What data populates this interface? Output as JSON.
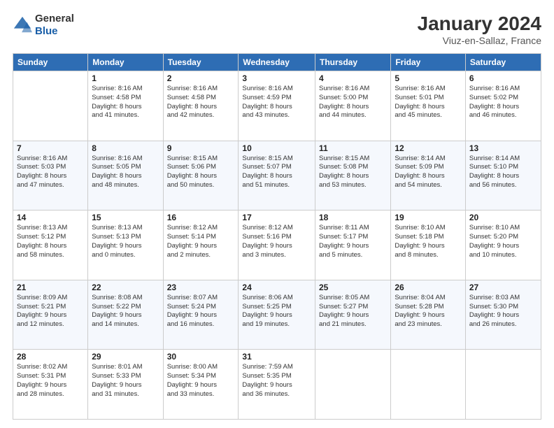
{
  "header": {
    "logo": {
      "general": "General",
      "blue": "Blue"
    },
    "title": "January 2024",
    "location": "Viuz-en-Sallaz, France"
  },
  "weekdays": [
    "Sunday",
    "Monday",
    "Tuesday",
    "Wednesday",
    "Thursday",
    "Friday",
    "Saturday"
  ],
  "weeks": [
    [
      {
        "day": "",
        "info": ""
      },
      {
        "day": "1",
        "info": "Sunrise: 8:16 AM\nSunset: 4:58 PM\nDaylight: 8 hours\nand 41 minutes."
      },
      {
        "day": "2",
        "info": "Sunrise: 8:16 AM\nSunset: 4:58 PM\nDaylight: 8 hours\nand 42 minutes."
      },
      {
        "day": "3",
        "info": "Sunrise: 8:16 AM\nSunset: 4:59 PM\nDaylight: 8 hours\nand 43 minutes."
      },
      {
        "day": "4",
        "info": "Sunrise: 8:16 AM\nSunset: 5:00 PM\nDaylight: 8 hours\nand 44 minutes."
      },
      {
        "day": "5",
        "info": "Sunrise: 8:16 AM\nSunset: 5:01 PM\nDaylight: 8 hours\nand 45 minutes."
      },
      {
        "day": "6",
        "info": "Sunrise: 8:16 AM\nSunset: 5:02 PM\nDaylight: 8 hours\nand 46 minutes."
      }
    ],
    [
      {
        "day": "7",
        "info": "Sunrise: 8:16 AM\nSunset: 5:03 PM\nDaylight: 8 hours\nand 47 minutes."
      },
      {
        "day": "8",
        "info": "Sunrise: 8:16 AM\nSunset: 5:05 PM\nDaylight: 8 hours\nand 48 minutes."
      },
      {
        "day": "9",
        "info": "Sunrise: 8:15 AM\nSunset: 5:06 PM\nDaylight: 8 hours\nand 50 minutes."
      },
      {
        "day": "10",
        "info": "Sunrise: 8:15 AM\nSunset: 5:07 PM\nDaylight: 8 hours\nand 51 minutes."
      },
      {
        "day": "11",
        "info": "Sunrise: 8:15 AM\nSunset: 5:08 PM\nDaylight: 8 hours\nand 53 minutes."
      },
      {
        "day": "12",
        "info": "Sunrise: 8:14 AM\nSunset: 5:09 PM\nDaylight: 8 hours\nand 54 minutes."
      },
      {
        "day": "13",
        "info": "Sunrise: 8:14 AM\nSunset: 5:10 PM\nDaylight: 8 hours\nand 56 minutes."
      }
    ],
    [
      {
        "day": "14",
        "info": "Sunrise: 8:13 AM\nSunset: 5:12 PM\nDaylight: 8 hours\nand 58 minutes."
      },
      {
        "day": "15",
        "info": "Sunrise: 8:13 AM\nSunset: 5:13 PM\nDaylight: 9 hours\nand 0 minutes."
      },
      {
        "day": "16",
        "info": "Sunrise: 8:12 AM\nSunset: 5:14 PM\nDaylight: 9 hours\nand 2 minutes."
      },
      {
        "day": "17",
        "info": "Sunrise: 8:12 AM\nSunset: 5:16 PM\nDaylight: 9 hours\nand 3 minutes."
      },
      {
        "day": "18",
        "info": "Sunrise: 8:11 AM\nSunset: 5:17 PM\nDaylight: 9 hours\nand 5 minutes."
      },
      {
        "day": "19",
        "info": "Sunrise: 8:10 AM\nSunset: 5:18 PM\nDaylight: 9 hours\nand 8 minutes."
      },
      {
        "day": "20",
        "info": "Sunrise: 8:10 AM\nSunset: 5:20 PM\nDaylight: 9 hours\nand 10 minutes."
      }
    ],
    [
      {
        "day": "21",
        "info": "Sunrise: 8:09 AM\nSunset: 5:21 PM\nDaylight: 9 hours\nand 12 minutes."
      },
      {
        "day": "22",
        "info": "Sunrise: 8:08 AM\nSunset: 5:22 PM\nDaylight: 9 hours\nand 14 minutes."
      },
      {
        "day": "23",
        "info": "Sunrise: 8:07 AM\nSunset: 5:24 PM\nDaylight: 9 hours\nand 16 minutes."
      },
      {
        "day": "24",
        "info": "Sunrise: 8:06 AM\nSunset: 5:25 PM\nDaylight: 9 hours\nand 19 minutes."
      },
      {
        "day": "25",
        "info": "Sunrise: 8:05 AM\nSunset: 5:27 PM\nDaylight: 9 hours\nand 21 minutes."
      },
      {
        "day": "26",
        "info": "Sunrise: 8:04 AM\nSunset: 5:28 PM\nDaylight: 9 hours\nand 23 minutes."
      },
      {
        "day": "27",
        "info": "Sunrise: 8:03 AM\nSunset: 5:30 PM\nDaylight: 9 hours\nand 26 minutes."
      }
    ],
    [
      {
        "day": "28",
        "info": "Sunrise: 8:02 AM\nSunset: 5:31 PM\nDaylight: 9 hours\nand 28 minutes."
      },
      {
        "day": "29",
        "info": "Sunrise: 8:01 AM\nSunset: 5:33 PM\nDaylight: 9 hours\nand 31 minutes."
      },
      {
        "day": "30",
        "info": "Sunrise: 8:00 AM\nSunset: 5:34 PM\nDaylight: 9 hours\nand 33 minutes."
      },
      {
        "day": "31",
        "info": "Sunrise: 7:59 AM\nSunset: 5:35 PM\nDaylight: 9 hours\nand 36 minutes."
      },
      {
        "day": "",
        "info": ""
      },
      {
        "day": "",
        "info": ""
      },
      {
        "day": "",
        "info": ""
      }
    ]
  ]
}
